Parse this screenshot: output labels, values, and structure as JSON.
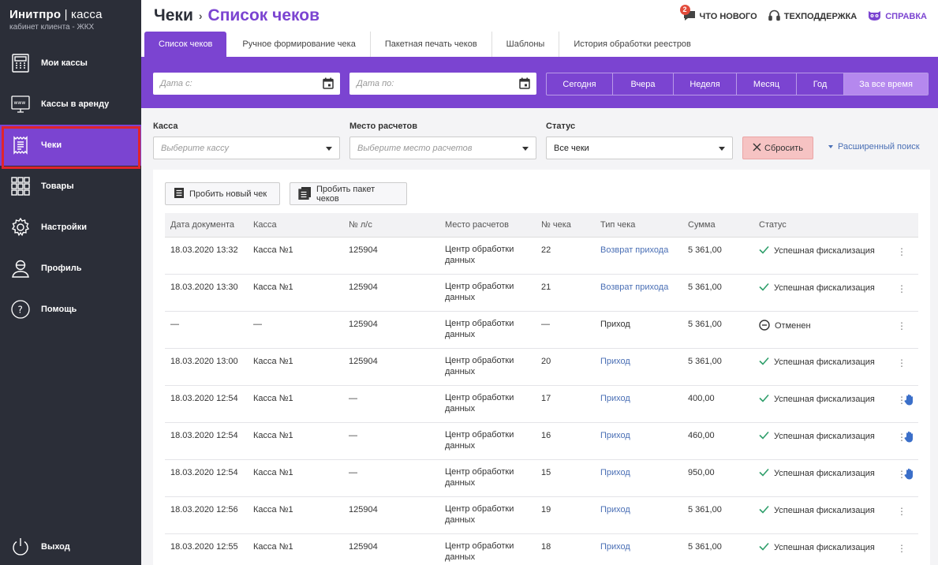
{
  "brand": {
    "title_bold": "Инитпро",
    "title_sep": " | ",
    "title_thin": "касса",
    "subtitle": "кабинет клиента - ЖКХ"
  },
  "sidebar": {
    "items": [
      {
        "label": "Мои кассы",
        "icon": "cash-register-icon"
      },
      {
        "label": "Кассы в аренду",
        "icon": "web-register-icon"
      },
      {
        "label": "Чеки",
        "icon": "receipt-icon",
        "active": true
      },
      {
        "label": "Товары",
        "icon": "grid-icon"
      },
      {
        "label": "Настройки",
        "icon": "gear-icon"
      },
      {
        "label": "Профиль",
        "icon": "user-icon"
      },
      {
        "label": "Помощь",
        "icon": "help-icon"
      }
    ],
    "logout": {
      "label": "Выход",
      "icon": "power-icon"
    }
  },
  "header": {
    "crumb_root": "Чеки",
    "crumb_sep": "›",
    "crumb_current": "Список чеков",
    "news": {
      "label": "ЧТО НОВОГО",
      "badge": "2"
    },
    "support": {
      "label": "ТЕХПОДДЕРЖКА"
    },
    "help": {
      "label": "СПРАВКА"
    }
  },
  "tabs": [
    {
      "label": "Список чеков",
      "active": true
    },
    {
      "label": "Ручное формирование чека"
    },
    {
      "label": "Пакетная печать чеков"
    },
    {
      "label": "Шаблоны"
    },
    {
      "label": "История обработки реестров"
    }
  ],
  "dates": {
    "from_placeholder": "Дата с:",
    "to_placeholder": "Дата по:"
  },
  "periods": [
    {
      "label": "Сегодня"
    },
    {
      "label": "Вчера"
    },
    {
      "label": "Неделя"
    },
    {
      "label": "Месяц"
    },
    {
      "label": "Год"
    },
    {
      "label": "За все время",
      "active": true
    }
  ],
  "filters": {
    "register": {
      "label": "Касса",
      "placeholder": "Выберите кассу"
    },
    "place": {
      "label": "Место расчетов",
      "placeholder": "Выберите место расчетов"
    },
    "status": {
      "label": "Статус",
      "value": "Все чеки"
    },
    "reset": "Сбросить",
    "advanced": "Расширенный поиск"
  },
  "actions": {
    "new_receipt": "Пробить новый чек",
    "batch_receipts": "Пробить пакет чеков"
  },
  "table": {
    "columns": [
      "Дата документа",
      "Касса",
      "№ л/с",
      "Место расчетов",
      "№ чека",
      "Тип чека",
      "Сумма",
      "Статус"
    ],
    "rows": [
      {
        "date": "18.03.2020 13:32",
        "kassa": "Касса №1",
        "account": "125904",
        "place": "Центр обработки данных",
        "num": "22",
        "type": "Возврат прихода",
        "type_link": true,
        "sum": "5 361,00",
        "status": "Успешная фискализация",
        "status_kind": "ok",
        "hand": false
      },
      {
        "date": "18.03.2020 13:30",
        "kassa": "Касса №1",
        "account": "125904",
        "place": "Центр обработки данных",
        "num": "21",
        "type": "Возврат прихода",
        "type_link": true,
        "sum": "5 361,00",
        "status": "Успешная фискализация",
        "status_kind": "ok",
        "hand": false
      },
      {
        "date": "—",
        "kassa": "—",
        "account": "125904",
        "place": "Центр обработки данных",
        "num": "—",
        "type": "Приход",
        "type_link": false,
        "sum": "5 361,00",
        "status": "Отменен",
        "status_kind": "cancel",
        "hand": false
      },
      {
        "date": "18.03.2020 13:00",
        "kassa": "Касса №1",
        "account": "125904",
        "place": "Центр обработки данных",
        "num": "20",
        "type": "Приход",
        "type_link": true,
        "sum": "5 361,00",
        "status": "Успешная фискализация",
        "status_kind": "ok",
        "hand": false
      },
      {
        "date": "18.03.2020 12:54",
        "kassa": "Касса №1",
        "account": "—",
        "place": "Центр обработки данных",
        "num": "17",
        "type": "Приход",
        "type_link": true,
        "sum": "400,00",
        "status": "Успешная фискализация",
        "status_kind": "ok",
        "hand": true
      },
      {
        "date": "18.03.2020 12:54",
        "kassa": "Касса №1",
        "account": "—",
        "place": "Центр обработки данных",
        "num": "16",
        "type": "Приход",
        "type_link": true,
        "sum": "460,00",
        "status": "Успешная фискализация",
        "status_kind": "ok",
        "hand": true
      },
      {
        "date": "18.03.2020 12:54",
        "kassa": "Касса №1",
        "account": "—",
        "place": "Центр обработки данных",
        "num": "15",
        "type": "Приход",
        "type_link": true,
        "sum": "950,00",
        "status": "Успешная фискализация",
        "status_kind": "ok",
        "hand": true
      },
      {
        "date": "18.03.2020 12:56",
        "kassa": "Касса №1",
        "account": "125904",
        "place": "Центр обработки данных",
        "num": "19",
        "type": "Приход",
        "type_link": true,
        "sum": "5 361,00",
        "status": "Успешная фискализация",
        "status_kind": "ok",
        "hand": false
      },
      {
        "date": "18.03.2020 12:55",
        "kassa": "Касса №1",
        "account": "125904",
        "place": "Центр обработки данных",
        "num": "18",
        "type": "Приход",
        "type_link": true,
        "sum": "5 361,00",
        "status": "Успешная фискализация",
        "status_kind": "ok",
        "hand": false
      }
    ],
    "menu_glyph": "⋮"
  },
  "colors": {
    "purple": "#7b44d1",
    "sidebar": "#2b2e38",
    "link": "#4a6fb5",
    "ok": "#2e9e6a",
    "highlight_border": "#e0242b"
  }
}
